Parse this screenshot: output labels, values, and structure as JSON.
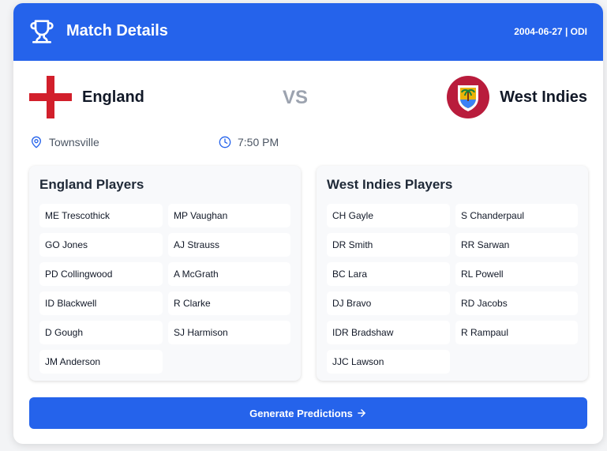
{
  "header": {
    "title": "Match Details",
    "date": "2004-06-27",
    "separator": "|",
    "format": "ODI",
    "icon": "trophy-icon"
  },
  "teams": {
    "home": {
      "name": "England",
      "flag_icon": "england-flag-icon"
    },
    "vs_label": "VS",
    "away": {
      "name": "West Indies",
      "flag_icon": "west-indies-flag-icon"
    }
  },
  "info": {
    "venue": "Townsville",
    "venue_icon": "map-pin-icon",
    "time": "7:50 PM",
    "time_icon": "clock-icon"
  },
  "home_players": {
    "heading": "England Players",
    "list": [
      "ME Trescothick",
      "MP Vaughan",
      "GO Jones",
      "AJ Strauss",
      "PD Collingwood",
      "A McGrath",
      "ID Blackwell",
      "R Clarke",
      "D Gough",
      "SJ Harmison",
      "JM Anderson"
    ]
  },
  "away_players": {
    "heading": "West Indies Players",
    "list": [
      "CH Gayle",
      "S Chanderpaul",
      "DR Smith",
      "RR Sarwan",
      "BC Lara",
      "RL Powell",
      "DJ Bravo",
      "RD Jacobs",
      "IDR Bradshaw",
      "R Rampaul",
      "JJC Lawson"
    ]
  },
  "action": {
    "label": "Generate Predictions",
    "icon": "arrow-right-icon"
  },
  "colors": {
    "accent": "#2563eb",
    "vs": "#9ca3af",
    "wi_maroon": "#b91c3c"
  }
}
